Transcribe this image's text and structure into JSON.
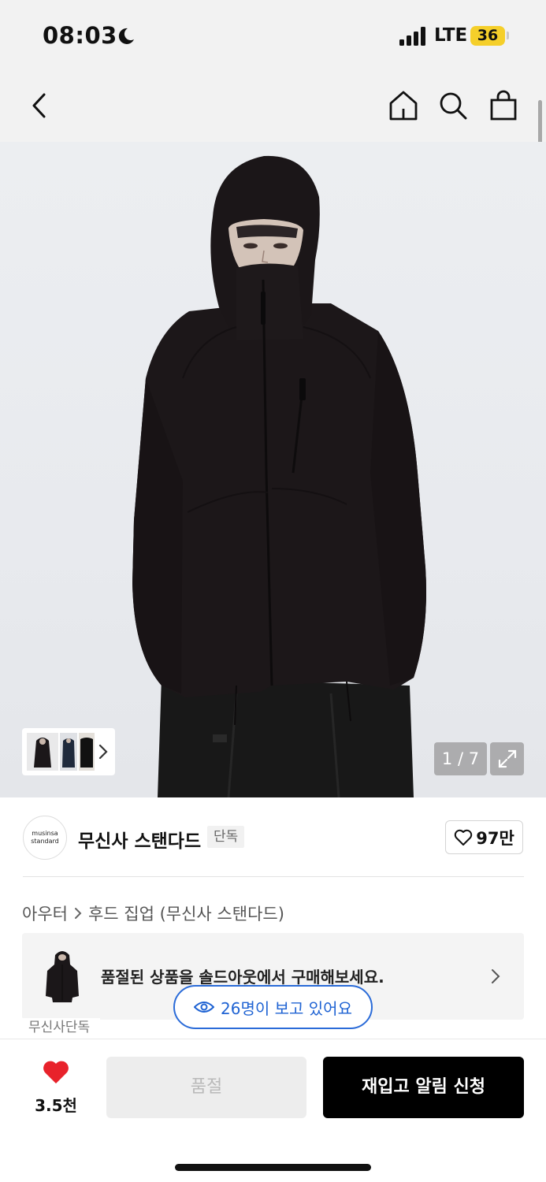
{
  "status_bar": {
    "time": "08:03",
    "network": "LTE",
    "battery": "36"
  },
  "header": {
    "icons": [
      "back-icon",
      "home-icon",
      "search-icon",
      "bag-icon"
    ]
  },
  "gallery": {
    "counter": "1 / 7",
    "expand_icon": "expand-icon"
  },
  "brand": {
    "logo_line1": "musinsa",
    "logo_line2": "standard",
    "name": "무신사 스탠다드",
    "badge": "단독",
    "likes": "97만"
  },
  "breadcrumb": {
    "category": "아우터",
    "subcategory": "후드 집업 (무신사 스탠다드)"
  },
  "soldout_banner": {
    "text": "품절된 상품을 솔드아웃에서 구매해보세요."
  },
  "viewers": {
    "text": "26명이 보고 있어요"
  },
  "exclusive_tag": "무신사단독",
  "bottom_bar": {
    "heart_count": "3.5천",
    "soldout_label": "품절",
    "restock_label": "재입고 알림 신청"
  },
  "colors": {
    "accent_blue": "#2a6bd8",
    "heart_red": "#e8222b",
    "battery_yellow": "#f5cf2a"
  }
}
